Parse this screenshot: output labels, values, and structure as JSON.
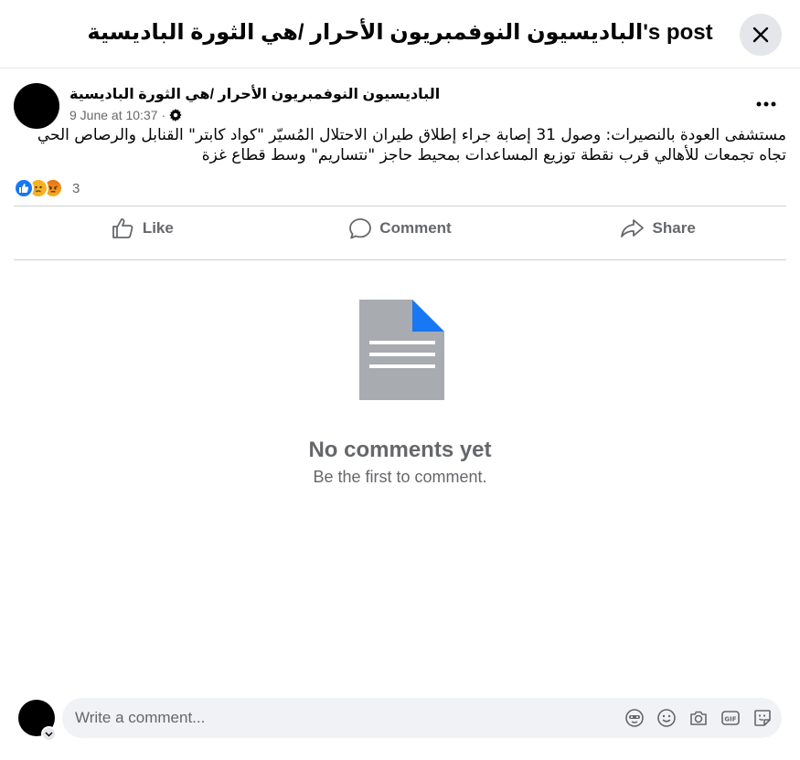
{
  "header": {
    "title": "الباديسيون النوفمبريون الأحرار /هي الثورة الباديسية's post"
  },
  "post": {
    "author": "الباديسيون النوفمبريون الأحرار /هي الثورة الباديسية",
    "timestamp": "9 June at 10:37",
    "separator": "·",
    "text": "مستشفى العودة بالنصيرات: وصول 31 إصابة جراء إطلاق طيران الاحتلال المُسيّر \"كواد كابتر\" القنابل والرصاص الحي تجاه تجمعات للأهالي قرب نقطة توزيع المساعدات بمحيط حاجز \"نتساريم\" وسط قطاع غزة",
    "reaction_count": "3",
    "reactions": [
      "like",
      "sad",
      "angry"
    ]
  },
  "actions": {
    "like": "Like",
    "comment": "Comment",
    "share": "Share"
  },
  "empty": {
    "title": "No comments yet",
    "subtitle": "Be the first to comment."
  },
  "composer": {
    "placeholder": "Write a comment...",
    "icons": [
      "avatar-sticker-icon",
      "emoji-icon",
      "camera-icon",
      "gif-icon",
      "sticker-icon"
    ]
  },
  "colors": {
    "like_blue": "#1877f2",
    "reaction_yellow": "#f7b125",
    "angry_orange": "#e9710f",
    "muted_text": "#65676b",
    "doc_gray": "#a8abb0",
    "doc_corner_blue": "#1877f2"
  }
}
